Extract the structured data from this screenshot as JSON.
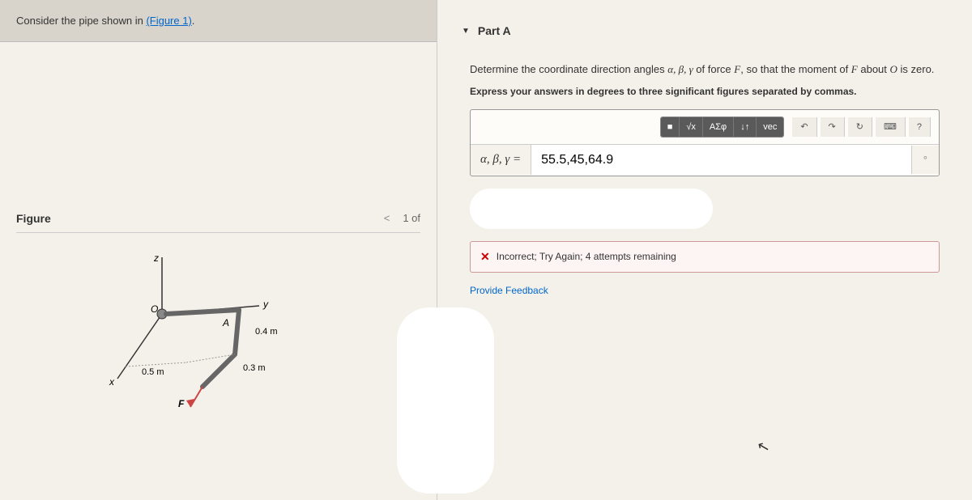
{
  "left": {
    "problem_intro": "Consider the pipe shown in ",
    "problem_link": "(Figure 1)",
    "figure_title": "Figure",
    "figure_nav_prev": "<",
    "figure_page": "1 of",
    "diagram": {
      "z": "z",
      "y": "y",
      "x": "x",
      "O": "O",
      "A": "A",
      "F": "F",
      "d1": "0.4 m",
      "d2": "0.3 m",
      "d3": "0.5 m"
    }
  },
  "right": {
    "part_label": "Part A",
    "prompt_pre": "Determine the coordinate direction angles ",
    "prompt_vars": "α, β, γ",
    "prompt_mid": " of force ",
    "prompt_F": "F",
    "prompt_post": ", so that the moment of ",
    "prompt_F2": "F",
    "prompt_about": " about ",
    "prompt_O": "O",
    "prompt_end": " is zero.",
    "instruction": "Express your answers in degrees to three significant figures separated by commas.",
    "toolbar": {
      "templates": "■",
      "sqrt": "√x",
      "greek": "ΑΣφ",
      "subscript": "↓↑",
      "vec": "vec",
      "undo": "↶",
      "redo": "↷",
      "reset": "↻",
      "keyboard": "⌨",
      "help": "?"
    },
    "answer_label": "α, β, γ =",
    "answer_value": "55.5,45,64.9",
    "unit_symbol": "°",
    "feedback_icon": "✕",
    "feedback_text": "Incorrect; Try Again; 4 attempts remaining",
    "feedback_link": "Provide Feedback"
  }
}
